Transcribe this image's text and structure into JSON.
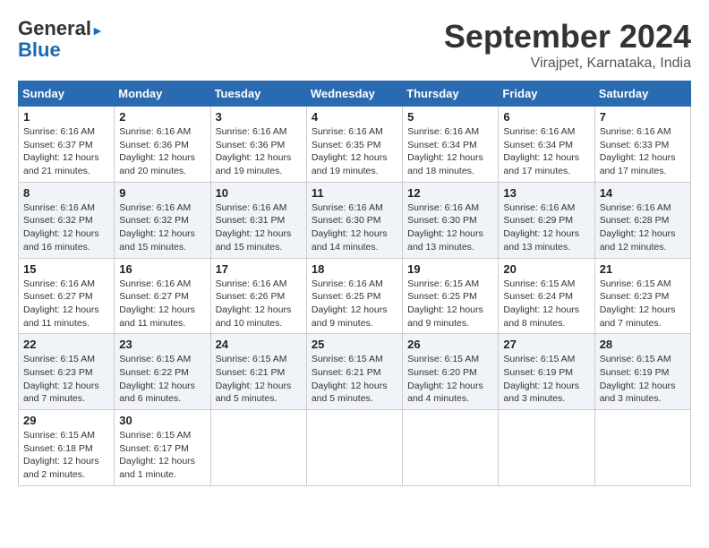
{
  "header": {
    "logo_line1": "General",
    "logo_line2": "Blue",
    "month": "September 2024",
    "location": "Virajpet, Karnataka, India"
  },
  "days_of_week": [
    "Sunday",
    "Monday",
    "Tuesday",
    "Wednesday",
    "Thursday",
    "Friday",
    "Saturday"
  ],
  "weeks": [
    [
      {
        "day": "1",
        "sunrise": "6:16 AM",
        "sunset": "6:37 PM",
        "daylight": "12 hours and 21 minutes."
      },
      {
        "day": "2",
        "sunrise": "6:16 AM",
        "sunset": "6:36 PM",
        "daylight": "12 hours and 20 minutes."
      },
      {
        "day": "3",
        "sunrise": "6:16 AM",
        "sunset": "6:36 PM",
        "daylight": "12 hours and 19 minutes."
      },
      {
        "day": "4",
        "sunrise": "6:16 AM",
        "sunset": "6:35 PM",
        "daylight": "12 hours and 19 minutes."
      },
      {
        "day": "5",
        "sunrise": "6:16 AM",
        "sunset": "6:34 PM",
        "daylight": "12 hours and 18 minutes."
      },
      {
        "day": "6",
        "sunrise": "6:16 AM",
        "sunset": "6:34 PM",
        "daylight": "12 hours and 17 minutes."
      },
      {
        "day": "7",
        "sunrise": "6:16 AM",
        "sunset": "6:33 PM",
        "daylight": "12 hours and 17 minutes."
      }
    ],
    [
      {
        "day": "8",
        "sunrise": "6:16 AM",
        "sunset": "6:32 PM",
        "daylight": "12 hours and 16 minutes."
      },
      {
        "day": "9",
        "sunrise": "6:16 AM",
        "sunset": "6:32 PM",
        "daylight": "12 hours and 15 minutes."
      },
      {
        "day": "10",
        "sunrise": "6:16 AM",
        "sunset": "6:31 PM",
        "daylight": "12 hours and 15 minutes."
      },
      {
        "day": "11",
        "sunrise": "6:16 AM",
        "sunset": "6:30 PM",
        "daylight": "12 hours and 14 minutes."
      },
      {
        "day": "12",
        "sunrise": "6:16 AM",
        "sunset": "6:30 PM",
        "daylight": "12 hours and 13 minutes."
      },
      {
        "day": "13",
        "sunrise": "6:16 AM",
        "sunset": "6:29 PM",
        "daylight": "12 hours and 13 minutes."
      },
      {
        "day": "14",
        "sunrise": "6:16 AM",
        "sunset": "6:28 PM",
        "daylight": "12 hours and 12 minutes."
      }
    ],
    [
      {
        "day": "15",
        "sunrise": "6:16 AM",
        "sunset": "6:27 PM",
        "daylight": "12 hours and 11 minutes."
      },
      {
        "day": "16",
        "sunrise": "6:16 AM",
        "sunset": "6:27 PM",
        "daylight": "12 hours and 11 minutes."
      },
      {
        "day": "17",
        "sunrise": "6:16 AM",
        "sunset": "6:26 PM",
        "daylight": "12 hours and 10 minutes."
      },
      {
        "day": "18",
        "sunrise": "6:16 AM",
        "sunset": "6:25 PM",
        "daylight": "12 hours and 9 minutes."
      },
      {
        "day": "19",
        "sunrise": "6:15 AM",
        "sunset": "6:25 PM",
        "daylight": "12 hours and 9 minutes."
      },
      {
        "day": "20",
        "sunrise": "6:15 AM",
        "sunset": "6:24 PM",
        "daylight": "12 hours and 8 minutes."
      },
      {
        "day": "21",
        "sunrise": "6:15 AM",
        "sunset": "6:23 PM",
        "daylight": "12 hours and 7 minutes."
      }
    ],
    [
      {
        "day": "22",
        "sunrise": "6:15 AM",
        "sunset": "6:23 PM",
        "daylight": "12 hours and 7 minutes."
      },
      {
        "day": "23",
        "sunrise": "6:15 AM",
        "sunset": "6:22 PM",
        "daylight": "12 hours and 6 minutes."
      },
      {
        "day": "24",
        "sunrise": "6:15 AM",
        "sunset": "6:21 PM",
        "daylight": "12 hours and 5 minutes."
      },
      {
        "day": "25",
        "sunrise": "6:15 AM",
        "sunset": "6:21 PM",
        "daylight": "12 hours and 5 minutes."
      },
      {
        "day": "26",
        "sunrise": "6:15 AM",
        "sunset": "6:20 PM",
        "daylight": "12 hours and 4 minutes."
      },
      {
        "day": "27",
        "sunrise": "6:15 AM",
        "sunset": "6:19 PM",
        "daylight": "12 hours and 3 minutes."
      },
      {
        "day": "28",
        "sunrise": "6:15 AM",
        "sunset": "6:19 PM",
        "daylight": "12 hours and 3 minutes."
      }
    ],
    [
      {
        "day": "29",
        "sunrise": "6:15 AM",
        "sunset": "6:18 PM",
        "daylight": "12 hours and 2 minutes."
      },
      {
        "day": "30",
        "sunrise": "6:15 AM",
        "sunset": "6:17 PM",
        "daylight": "12 hours and 1 minute."
      },
      null,
      null,
      null,
      null,
      null
    ]
  ],
  "labels": {
    "sunrise": "Sunrise:",
    "sunset": "Sunset:",
    "daylight": "Daylight:"
  }
}
